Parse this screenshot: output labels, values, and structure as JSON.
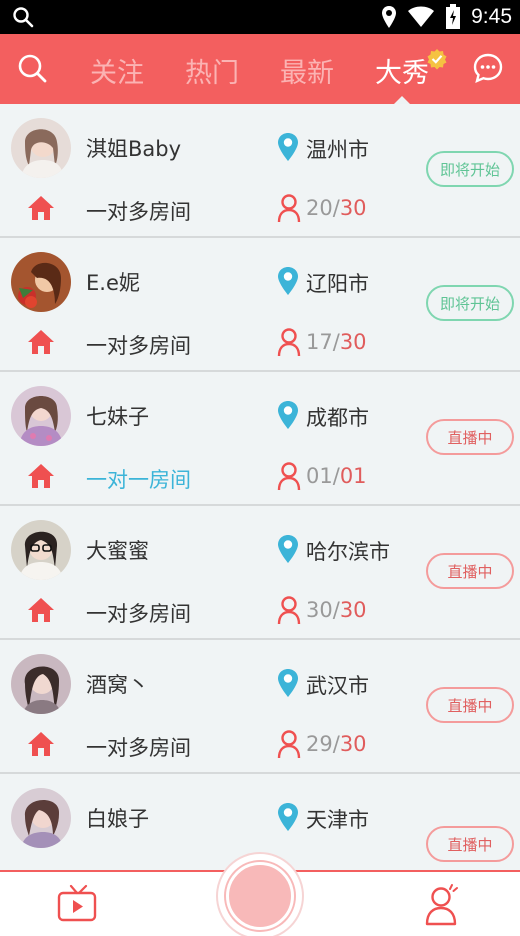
{
  "statusbar": {
    "time": "9:45"
  },
  "nav": {
    "tabs": [
      {
        "label": "关注",
        "active": false
      },
      {
        "label": "热门",
        "active": false
      },
      {
        "label": "最新",
        "active": false
      },
      {
        "label": "大秀",
        "active": true
      }
    ]
  },
  "rows": [
    {
      "name": "淇姐Baby",
      "city": "温州市",
      "room": "一对多房间",
      "current": "20",
      "max": "30",
      "status": "即将开始",
      "status_type": "upcoming",
      "room_highlight": false
    },
    {
      "name": "E.e妮",
      "city": "辽阳市",
      "room": "一对多房间",
      "current": "17",
      "max": "30",
      "status": "即将开始",
      "status_type": "upcoming",
      "room_highlight": false
    },
    {
      "name": "七妹子",
      "city": "成都市",
      "room": "一对一房间",
      "current": "01",
      "max": "01",
      "status": "直播中",
      "status_type": "live",
      "room_highlight": true
    },
    {
      "name": "大蜜蜜",
      "city": "哈尔滨市",
      "room": "一对多房间",
      "current": "30",
      "max": "30",
      "status": "直播中",
      "status_type": "live",
      "room_highlight": false
    },
    {
      "name": "酒窝丶",
      "city": "武汉市",
      "room": "一对多房间",
      "current": "29",
      "max": "30",
      "status": "直播中",
      "status_type": "live",
      "room_highlight": false
    },
    {
      "name": "白娘子",
      "city": "天津市",
      "room": "",
      "current": "",
      "max": "",
      "status": "直播中",
      "status_type": "live",
      "room_highlight": false
    }
  ],
  "colors": {
    "brand": "#f35f5f",
    "location": "#3cb4d8",
    "upcoming": "#5fc495",
    "live": "#e06060"
  }
}
